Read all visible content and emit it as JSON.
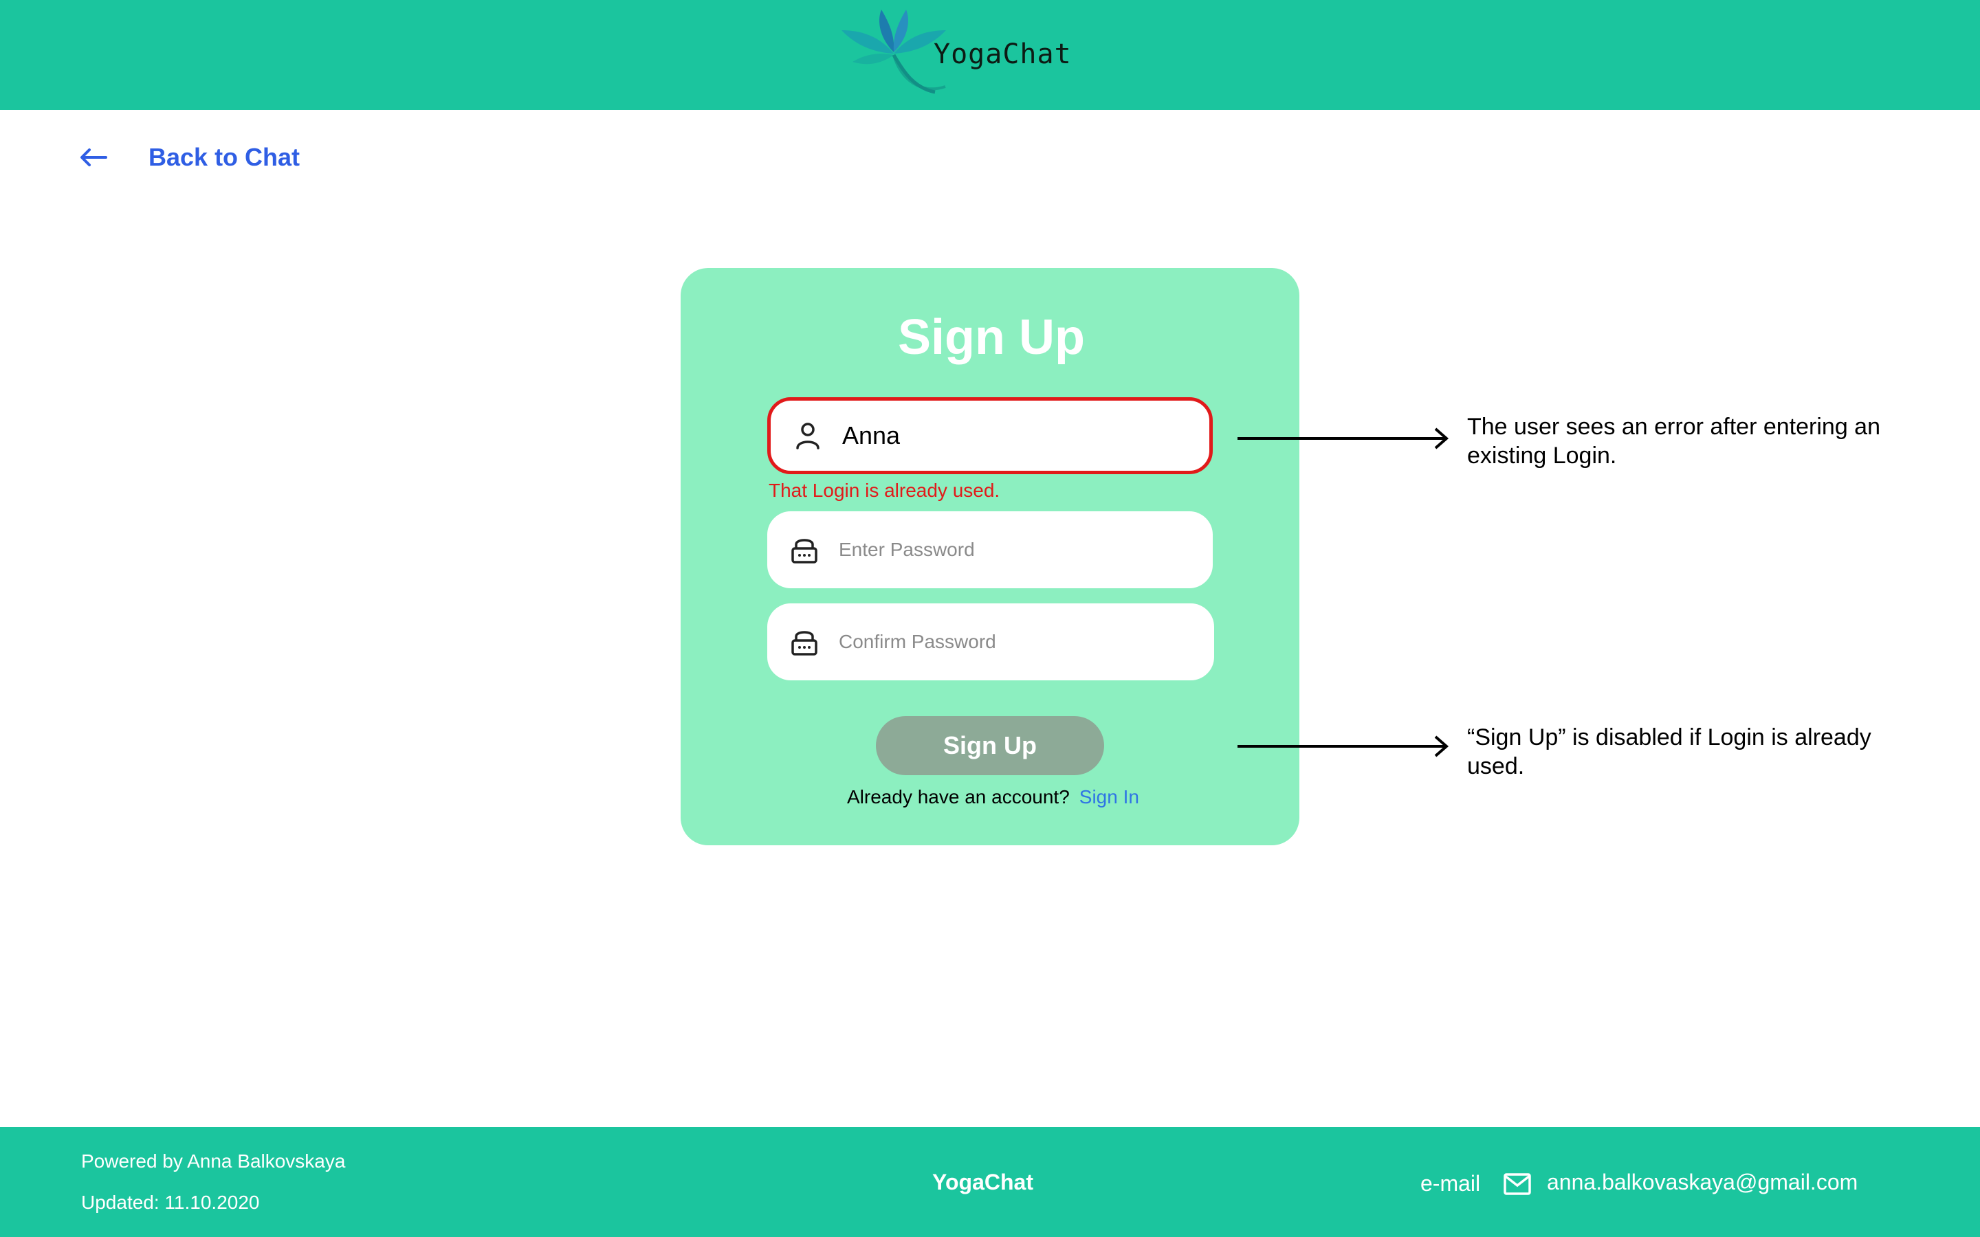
{
  "header": {
    "brand": "YogaChat",
    "logo_icon": "lotus-icon",
    "color": "#1BC59E"
  },
  "back": {
    "label": "Back to Chat",
    "icon": "arrow-left-icon"
  },
  "card": {
    "title": "Sign Up",
    "login_field": {
      "value": "Anna",
      "icon": "user-icon",
      "state": "error"
    },
    "error_message": "That Login is already used.",
    "password_field": {
      "placeholder": "Enter Password",
      "icon": "lock-icon"
    },
    "confirm_field": {
      "placeholder": "Confirm Password",
      "icon": "lock-icon"
    },
    "submit_label": "Sign Up",
    "submit_state": "disabled",
    "already_text": "Already have an account?",
    "signin_label": "Sign In"
  },
  "annotations": [
    {
      "text": "The user sees an error after entering an existing Login."
    },
    {
      "text": "“Sign Up” is disabled if Login is already used."
    }
  ],
  "footer": {
    "powered": "Powered by Anna Balkovskaya",
    "updated": "Updated: 11.10.2020",
    "brand": "YogaChat",
    "email_label": "e-mail",
    "email_icon": "mail-icon",
    "email": "anna.balkovaskaya@gmail.com"
  },
  "colors": {
    "accent": "#1BC59E",
    "card": "#8CEFC0",
    "error": "#E11A1A",
    "link": "#2F5EE4",
    "disabled_button": "#8DAA97"
  }
}
